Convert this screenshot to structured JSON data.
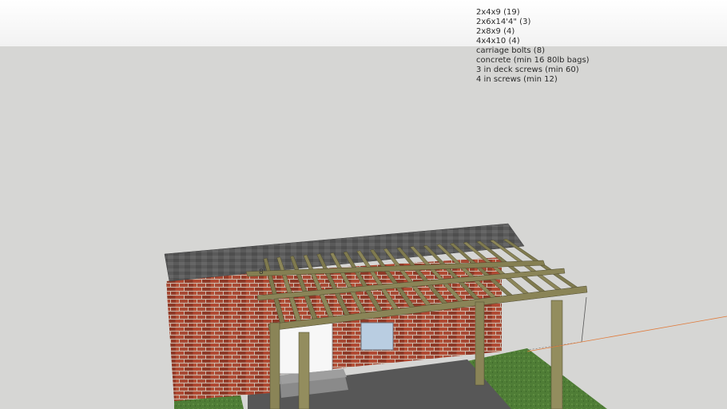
{
  "model": {
    "materials": [
      "2x4x9 (19)",
      "2x6x14'4\" (3)",
      "2x8x9 (4)",
      "4x4x10 (4)",
      "carriage bolts (8)",
      "concrete (min 16 80lb bags)",
      "3 in deck screws (min 60)",
      "4 in screws (min 12)"
    ],
    "dimension_label": "8'"
  },
  "colors": {
    "background": "#d6d6d4",
    "sky": "#f4f4f4",
    "brick": "#9c3f2c",
    "mortar": "#d9c8b8",
    "roof": "#5f5f5f",
    "lumber": "#8a8457",
    "lumber_dark": "#625e3c",
    "grass": "#4e7f35",
    "concrete": "#555555",
    "axis_red": "#e07a3a"
  }
}
